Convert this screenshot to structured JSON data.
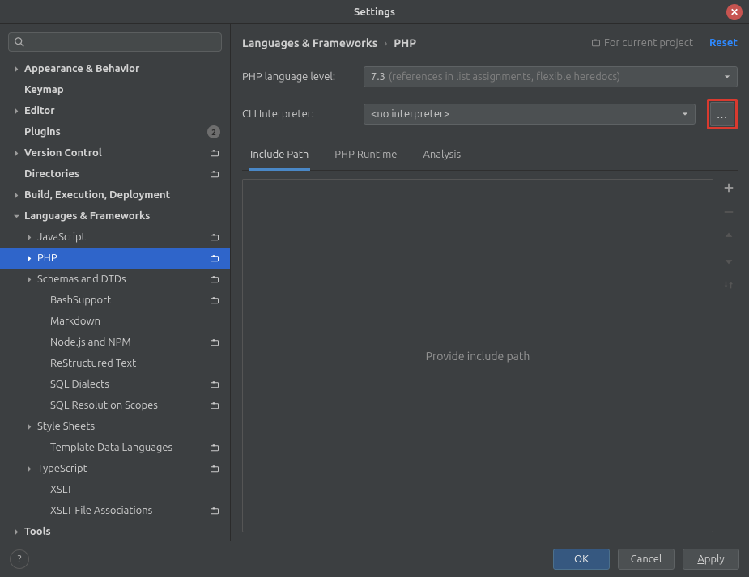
{
  "window": {
    "title": "Settings",
    "reset": "Reset"
  },
  "breadcrumb": {
    "a": "Languages & Frameworks",
    "sep": "›",
    "b": "PHP",
    "scope": "For current project"
  },
  "form": {
    "php_level_label": "PHP language level:",
    "php_level_value": "7.3",
    "php_level_hint": "(references in list assignments, flexible heredocs)",
    "cli_label": "CLI Interpreter:",
    "cli_value": "<no interpreter>"
  },
  "tabs": {
    "include": "Include Path",
    "runtime": "PHP Runtime",
    "analysis": "Analysis"
  },
  "panel": {
    "placeholder": "Provide include path"
  },
  "footer": {
    "ok": "OK",
    "cancel": "Cancel",
    "apply": "Apply"
  },
  "tree": [
    {
      "label": "Appearance & Behavior",
      "lvl": 0,
      "bold": true,
      "arrow": "right"
    },
    {
      "label": "Keymap",
      "lvl": 0,
      "bold": true
    },
    {
      "label": "Editor",
      "lvl": 0,
      "bold": true,
      "arrow": "right"
    },
    {
      "label": "Plugins",
      "lvl": 0,
      "bold": true,
      "badge": true
    },
    {
      "label": "Version Control",
      "lvl": 0,
      "bold": true,
      "arrow": "right",
      "proj": true
    },
    {
      "label": "Directories",
      "lvl": 0,
      "bold": true,
      "proj": true
    },
    {
      "label": "Build, Execution, Deployment",
      "lvl": 0,
      "bold": true,
      "arrow": "right"
    },
    {
      "label": "Languages & Frameworks",
      "lvl": 0,
      "bold": true,
      "arrow": "down"
    },
    {
      "label": "JavaScript",
      "lvl": 1,
      "arrow": "right",
      "proj": true
    },
    {
      "label": "PHP",
      "lvl": 1,
      "arrow": "right",
      "proj": true,
      "selected": true
    },
    {
      "label": "Schemas and DTDs",
      "lvl": 1,
      "arrow": "right",
      "proj": true
    },
    {
      "label": "BashSupport",
      "lvl": 2,
      "proj": true
    },
    {
      "label": "Markdown",
      "lvl": 2
    },
    {
      "label": "Node.js and NPM",
      "lvl": 2,
      "proj": true
    },
    {
      "label": "ReStructured Text",
      "lvl": 2
    },
    {
      "label": "SQL Dialects",
      "lvl": 2,
      "proj": true
    },
    {
      "label": "SQL Resolution Scopes",
      "lvl": 2,
      "proj": true
    },
    {
      "label": "Style Sheets",
      "lvl": 1,
      "arrow": "right"
    },
    {
      "label": "Template Data Languages",
      "lvl": 2,
      "proj": true
    },
    {
      "label": "TypeScript",
      "lvl": 1,
      "arrow": "right",
      "proj": true
    },
    {
      "label": "XSLT",
      "lvl": 2
    },
    {
      "label": "XSLT File Associations",
      "lvl": 2,
      "proj": true
    },
    {
      "label": "Tools",
      "lvl": 0,
      "bold": true,
      "arrow": "right"
    }
  ],
  "plugins_badge": "2"
}
